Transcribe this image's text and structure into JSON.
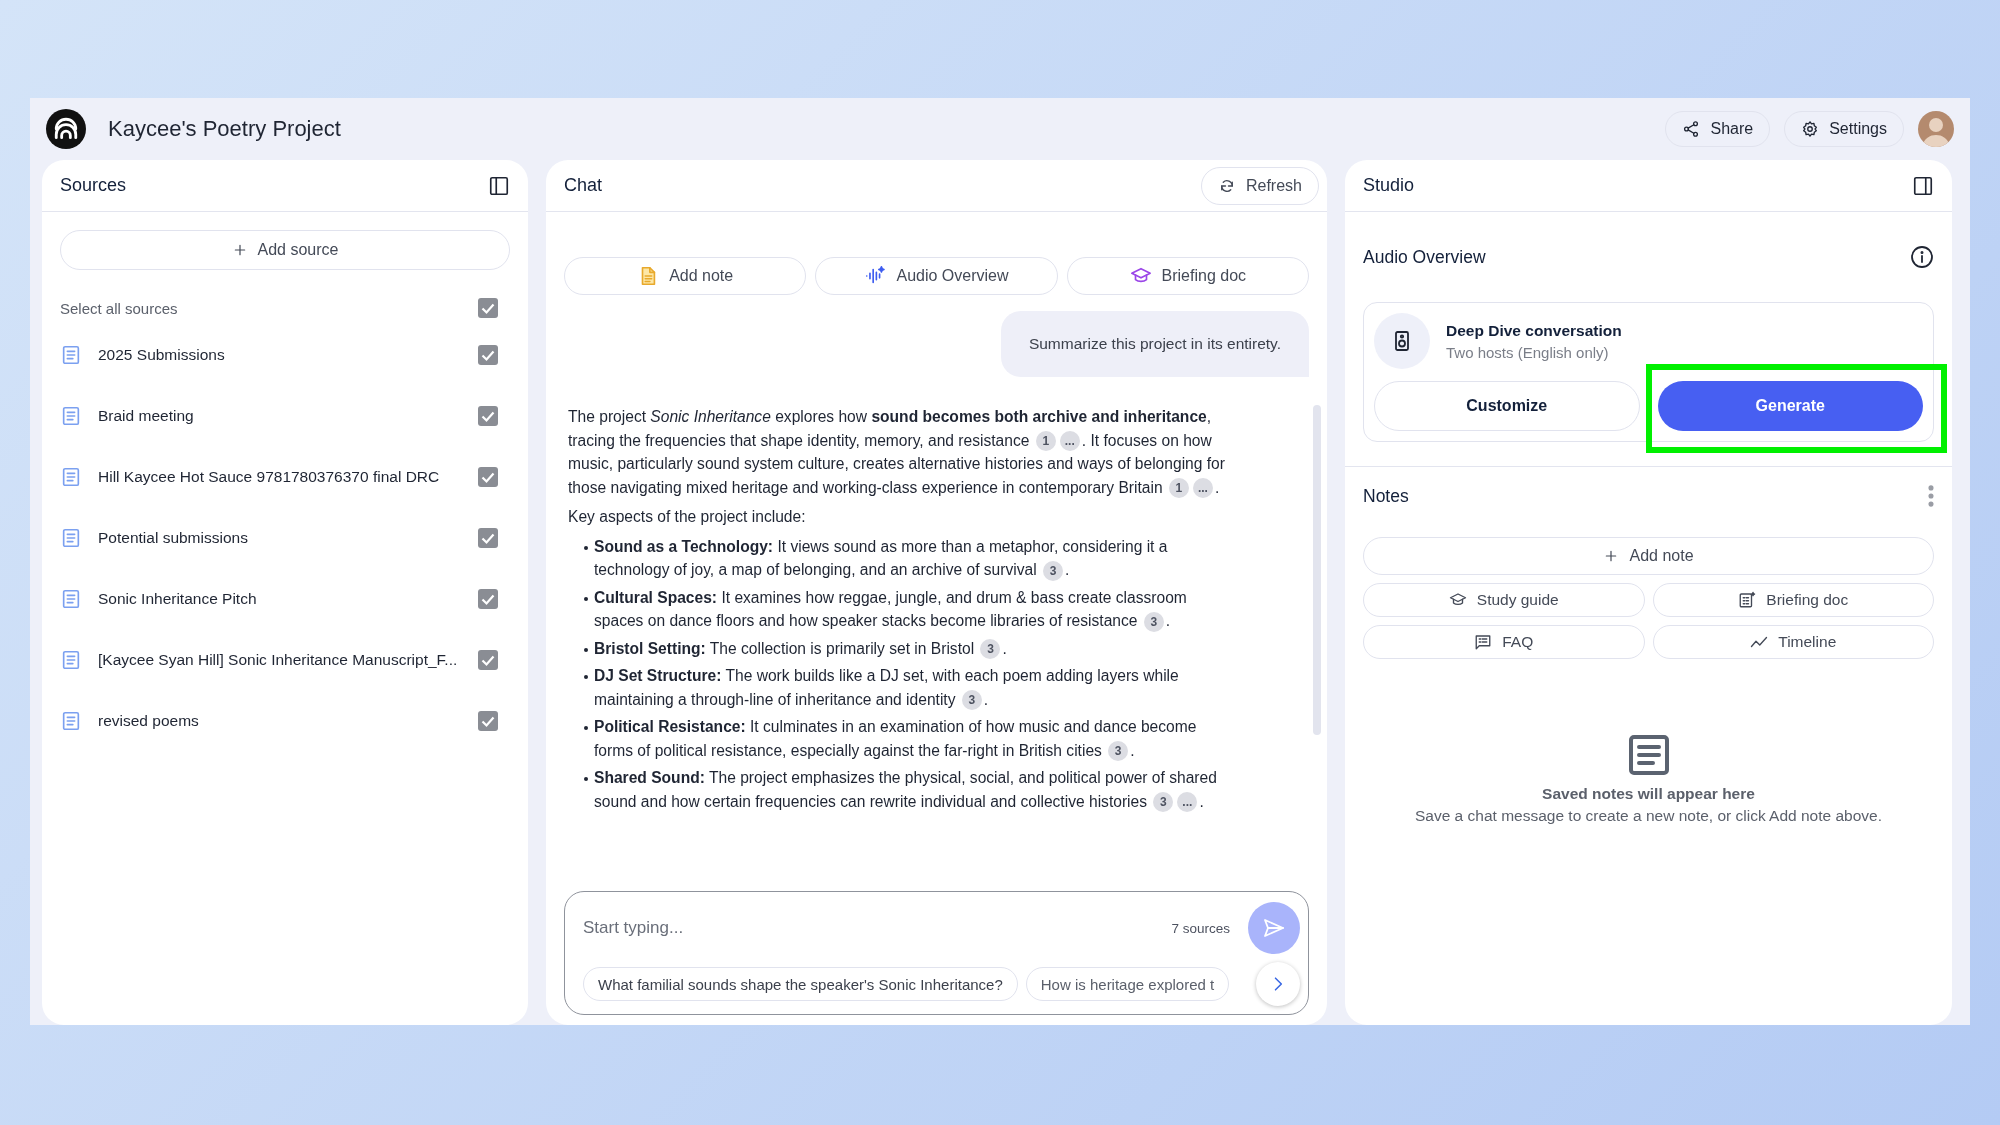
{
  "app": {
    "title": "Kaycee's Poetry Project",
    "share_label": "Share",
    "settings_label": "Settings"
  },
  "sources": {
    "title": "Sources",
    "add_label": "Add source",
    "select_all": {
      "label": "Select all sources",
      "checked": true
    },
    "items": [
      {
        "name": "2025 Submissions",
        "checked": true
      },
      {
        "name": "Braid meeting",
        "checked": true
      },
      {
        "name": "Hill Kaycee Hot Sauce 9781780376370 final DRC",
        "checked": true
      },
      {
        "name": "Potential submissions",
        "checked": true
      },
      {
        "name": "Sonic Inheritance Pitch",
        "checked": true
      },
      {
        "name": "[Kaycee Syan Hill] Sonic Inheritance Manuscript_F...",
        "checked": true
      },
      {
        "name": "revised poems",
        "checked": true
      }
    ]
  },
  "chat": {
    "title": "Chat",
    "refresh_label": "Refresh",
    "actions": [
      {
        "kind": "note",
        "label": "Add note"
      },
      {
        "kind": "audio",
        "label": "Audio Overview"
      },
      {
        "kind": "briefing",
        "label": "Briefing doc"
      }
    ],
    "user_message": "Summarize this project in its entirety.",
    "response": {
      "intro": [
        {
          "text": "The project *Sonic Inheritance* explores how **sound becomes both archive and inheritance**, tracing the frequencies that shape identity, memory, and resistance ",
          "citations": [
            "1",
            "..."
          ]
        },
        {
          "text": ". It focuses on how music, particularly sound system culture, creates alternative histories and ways of belonging for those navigating mixed heritage and working-class experience in contemporary Britain ",
          "citations": [
            "1",
            "..."
          ]
        },
        {
          "text": "."
        }
      ],
      "lead": "Key aspects of the project include:",
      "bullets": [
        {
          "parts": [
            {
              "text": "**Sound as a Technology:** It views sound as more than a metaphor, considering it a technology of joy, a map of belonging, and an archive of survival ",
              "citations": [
                "3"
              ]
            },
            {
              "text": "."
            }
          ]
        },
        {
          "parts": [
            {
              "text": "**Cultural Spaces:** It examines how reggae, jungle, and drum & bass create classroom spaces on dance floors and how speaker stacks become libraries of resistance ",
              "citations": [
                "3"
              ]
            },
            {
              "text": "."
            }
          ]
        },
        {
          "parts": [
            {
              "text": "**Bristol Setting:** The collection is primarily set in Bristol ",
              "citations": [
                "3"
              ]
            },
            {
              "text": "."
            }
          ]
        },
        {
          "parts": [
            {
              "text": "**DJ Set Structure:** The work builds like a DJ set, with each poem adding layers while maintaining a through-line of inheritance and identity ",
              "citations": [
                "3"
              ]
            },
            {
              "text": "."
            }
          ]
        },
        {
          "parts": [
            {
              "text": "**Political Resistance:** It culminates in an examination of how music and dance become forms of political resistance, especially against the far-right in British cities ",
              "citations": [
                "3"
              ]
            },
            {
              "text": "."
            }
          ]
        },
        {
          "parts": [
            {
              "text": "**Shared Sound:** The project emphasizes the physical, social, and political power of shared sound and how certain frequencies can rewrite individual and collective histories ",
              "citations": [
                "3",
                "..."
              ]
            },
            {
              "text": "."
            }
          ]
        }
      ]
    },
    "input": {
      "placeholder": "Start typing...",
      "source_count": "7 sources"
    },
    "suggestions": [
      "What familial sounds shape the speaker's Sonic Inheritance?",
      "How is heritage explored t"
    ]
  },
  "studio": {
    "title": "Studio",
    "audio_overview": {
      "title": "Audio Overview",
      "card_title": "Deep Dive conversation",
      "card_subtitle": "Two hosts (English only)",
      "buttons": [
        {
          "kind": "secondary",
          "label": "Customize",
          "highlighted": false
        },
        {
          "kind": "primary",
          "label": "Generate",
          "highlighted": true
        }
      ]
    },
    "notes": {
      "title": "Notes",
      "add_label": "Add note",
      "tools": [
        {
          "kind": "study",
          "label": "Study guide"
        },
        {
          "kind": "briefing",
          "label": "Briefing doc"
        },
        {
          "kind": "faq",
          "label": "FAQ"
        },
        {
          "kind": "timeline",
          "label": "Timeline"
        }
      ],
      "empty_title": "Saved notes will appear here",
      "empty_text": "Save a chat message to create a new note, or click Add note above."
    }
  }
}
